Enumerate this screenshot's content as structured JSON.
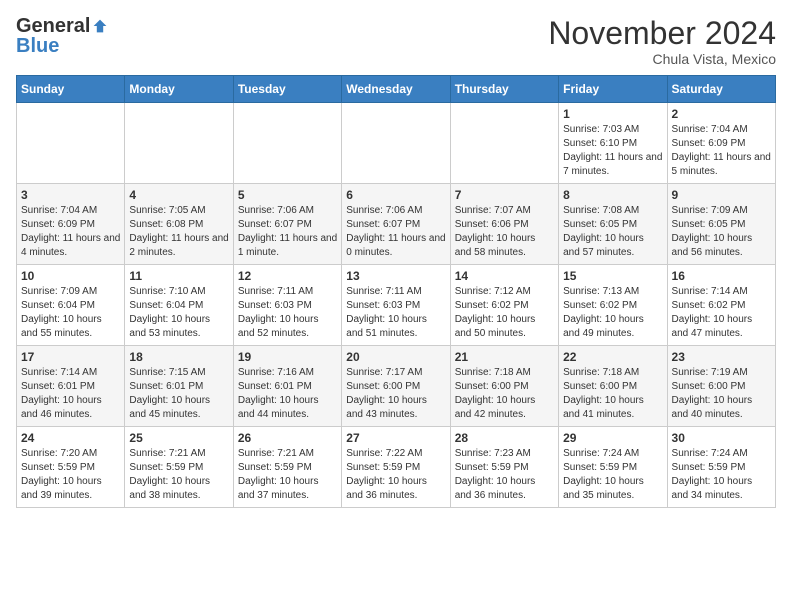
{
  "header": {
    "logo_general": "General",
    "logo_blue": "Blue",
    "month_title": "November 2024",
    "location": "Chula Vista, Mexico"
  },
  "calendar": {
    "headers": [
      "Sunday",
      "Monday",
      "Tuesday",
      "Wednesday",
      "Thursday",
      "Friday",
      "Saturday"
    ],
    "weeks": [
      [
        {
          "day": "",
          "info": ""
        },
        {
          "day": "",
          "info": ""
        },
        {
          "day": "",
          "info": ""
        },
        {
          "day": "",
          "info": ""
        },
        {
          "day": "",
          "info": ""
        },
        {
          "day": "1",
          "info": "Sunrise: 7:03 AM\nSunset: 6:10 PM\nDaylight: 11 hours and 7 minutes."
        },
        {
          "day": "2",
          "info": "Sunrise: 7:04 AM\nSunset: 6:09 PM\nDaylight: 11 hours and 5 minutes."
        }
      ],
      [
        {
          "day": "3",
          "info": "Sunrise: 7:04 AM\nSunset: 6:09 PM\nDaylight: 11 hours and 4 minutes."
        },
        {
          "day": "4",
          "info": "Sunrise: 7:05 AM\nSunset: 6:08 PM\nDaylight: 11 hours and 2 minutes."
        },
        {
          "day": "5",
          "info": "Sunrise: 7:06 AM\nSunset: 6:07 PM\nDaylight: 11 hours and 1 minute."
        },
        {
          "day": "6",
          "info": "Sunrise: 7:06 AM\nSunset: 6:07 PM\nDaylight: 11 hours and 0 minutes."
        },
        {
          "day": "7",
          "info": "Sunrise: 7:07 AM\nSunset: 6:06 PM\nDaylight: 10 hours and 58 minutes."
        },
        {
          "day": "8",
          "info": "Sunrise: 7:08 AM\nSunset: 6:05 PM\nDaylight: 10 hours and 57 minutes."
        },
        {
          "day": "9",
          "info": "Sunrise: 7:09 AM\nSunset: 6:05 PM\nDaylight: 10 hours and 56 minutes."
        }
      ],
      [
        {
          "day": "10",
          "info": "Sunrise: 7:09 AM\nSunset: 6:04 PM\nDaylight: 10 hours and 55 minutes."
        },
        {
          "day": "11",
          "info": "Sunrise: 7:10 AM\nSunset: 6:04 PM\nDaylight: 10 hours and 53 minutes."
        },
        {
          "day": "12",
          "info": "Sunrise: 7:11 AM\nSunset: 6:03 PM\nDaylight: 10 hours and 52 minutes."
        },
        {
          "day": "13",
          "info": "Sunrise: 7:11 AM\nSunset: 6:03 PM\nDaylight: 10 hours and 51 minutes."
        },
        {
          "day": "14",
          "info": "Sunrise: 7:12 AM\nSunset: 6:02 PM\nDaylight: 10 hours and 50 minutes."
        },
        {
          "day": "15",
          "info": "Sunrise: 7:13 AM\nSunset: 6:02 PM\nDaylight: 10 hours and 49 minutes."
        },
        {
          "day": "16",
          "info": "Sunrise: 7:14 AM\nSunset: 6:02 PM\nDaylight: 10 hours and 47 minutes."
        }
      ],
      [
        {
          "day": "17",
          "info": "Sunrise: 7:14 AM\nSunset: 6:01 PM\nDaylight: 10 hours and 46 minutes."
        },
        {
          "day": "18",
          "info": "Sunrise: 7:15 AM\nSunset: 6:01 PM\nDaylight: 10 hours and 45 minutes."
        },
        {
          "day": "19",
          "info": "Sunrise: 7:16 AM\nSunset: 6:01 PM\nDaylight: 10 hours and 44 minutes."
        },
        {
          "day": "20",
          "info": "Sunrise: 7:17 AM\nSunset: 6:00 PM\nDaylight: 10 hours and 43 minutes."
        },
        {
          "day": "21",
          "info": "Sunrise: 7:18 AM\nSunset: 6:00 PM\nDaylight: 10 hours and 42 minutes."
        },
        {
          "day": "22",
          "info": "Sunrise: 7:18 AM\nSunset: 6:00 PM\nDaylight: 10 hours and 41 minutes."
        },
        {
          "day": "23",
          "info": "Sunrise: 7:19 AM\nSunset: 6:00 PM\nDaylight: 10 hours and 40 minutes."
        }
      ],
      [
        {
          "day": "24",
          "info": "Sunrise: 7:20 AM\nSunset: 5:59 PM\nDaylight: 10 hours and 39 minutes."
        },
        {
          "day": "25",
          "info": "Sunrise: 7:21 AM\nSunset: 5:59 PM\nDaylight: 10 hours and 38 minutes."
        },
        {
          "day": "26",
          "info": "Sunrise: 7:21 AM\nSunset: 5:59 PM\nDaylight: 10 hours and 37 minutes."
        },
        {
          "day": "27",
          "info": "Sunrise: 7:22 AM\nSunset: 5:59 PM\nDaylight: 10 hours and 36 minutes."
        },
        {
          "day": "28",
          "info": "Sunrise: 7:23 AM\nSunset: 5:59 PM\nDaylight: 10 hours and 36 minutes."
        },
        {
          "day": "29",
          "info": "Sunrise: 7:24 AM\nSunset: 5:59 PM\nDaylight: 10 hours and 35 minutes."
        },
        {
          "day": "30",
          "info": "Sunrise: 7:24 AM\nSunset: 5:59 PM\nDaylight: 10 hours and 34 minutes."
        }
      ]
    ]
  }
}
